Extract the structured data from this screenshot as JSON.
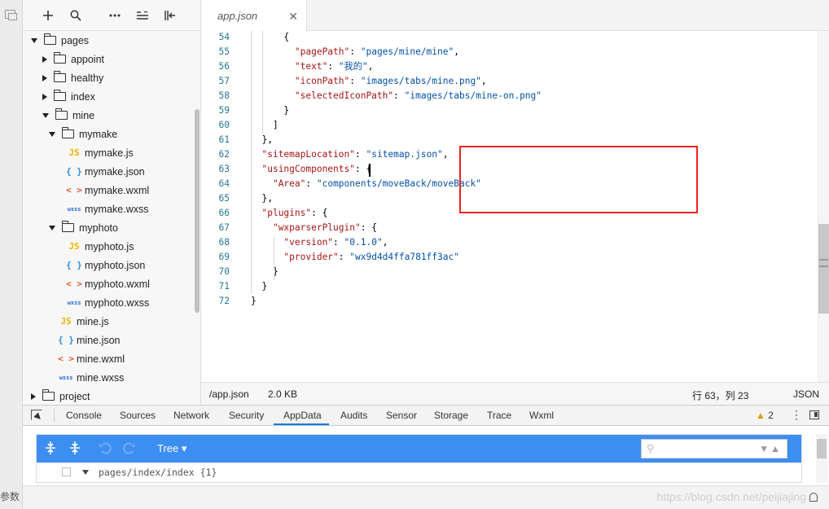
{
  "explorer": {
    "items": [
      {
        "label": "pages",
        "kind": "folder",
        "open": true,
        "depth": 0
      },
      {
        "label": "appoint",
        "kind": "folder",
        "open": false,
        "depth": 1
      },
      {
        "label": "healthy",
        "kind": "folder",
        "open": false,
        "depth": 1
      },
      {
        "label": "index",
        "kind": "folder",
        "open": false,
        "depth": 1
      },
      {
        "label": "mine",
        "kind": "folder",
        "open": true,
        "depth": 1
      },
      {
        "label": "mymake",
        "kind": "folder",
        "open": true,
        "depth": 2
      },
      {
        "label": "mymake.js",
        "kind": "js",
        "depth": 3
      },
      {
        "label": "mymake.json",
        "kind": "json",
        "depth": 3
      },
      {
        "label": "mymake.wxml",
        "kind": "wxml",
        "depth": 3
      },
      {
        "label": "mymake.wxss",
        "kind": "wxss",
        "depth": 3
      },
      {
        "label": "myphoto",
        "kind": "folder",
        "open": true,
        "depth": 2
      },
      {
        "label": "myphoto.js",
        "kind": "js",
        "depth": 3
      },
      {
        "label": "myphoto.json",
        "kind": "json",
        "depth": 3
      },
      {
        "label": "myphoto.wxml",
        "kind": "wxml",
        "depth": 3
      },
      {
        "label": "myphoto.wxss",
        "kind": "wxss",
        "depth": 3
      },
      {
        "label": "mine.js",
        "kind": "js",
        "depth": 2
      },
      {
        "label": "mine.json",
        "kind": "json",
        "depth": 2
      },
      {
        "label": "mine.wxml",
        "kind": "wxml",
        "depth": 2
      },
      {
        "label": "mine.wxss",
        "kind": "wxss",
        "depth": 2
      },
      {
        "label": "project",
        "kind": "folder",
        "open": false,
        "depth": 0
      }
    ],
    "file_icons": {
      "js": "JS",
      "json": "{ }",
      "wxml": "< >",
      "wxss": "wxss"
    }
  },
  "editor": {
    "tab_label": "app.json",
    "tab_close": "✕",
    "lines": [
      {
        "n": "54",
        "code": [
          [
            "      {",
            "p"
          ]
        ]
      },
      {
        "n": "55",
        "code": [
          [
            "        ",
            "p"
          ],
          [
            "\"pagePath\"",
            "k"
          ],
          [
            ": ",
            "p"
          ],
          [
            "\"pages/mine/mine\"",
            "s"
          ],
          [
            ",",
            "p"
          ]
        ]
      },
      {
        "n": "56",
        "code": [
          [
            "        ",
            "p"
          ],
          [
            "\"text\"",
            "k"
          ],
          [
            ": ",
            "p"
          ],
          [
            "\"我的\"",
            "s"
          ],
          [
            ",",
            "p"
          ]
        ]
      },
      {
        "n": "57",
        "code": [
          [
            "        ",
            "p"
          ],
          [
            "\"iconPath\"",
            "k"
          ],
          [
            ": ",
            "p"
          ],
          [
            "\"images/tabs/mine.png\"",
            "s"
          ],
          [
            ",",
            "p"
          ]
        ]
      },
      {
        "n": "58",
        "code": [
          [
            "        ",
            "p"
          ],
          [
            "\"selectedIconPath\"",
            "k"
          ],
          [
            ": ",
            "p"
          ],
          [
            "\"images/tabs/mine-on.png\"",
            "s"
          ]
        ]
      },
      {
        "n": "59",
        "code": [
          [
            "      }",
            "p"
          ]
        ]
      },
      {
        "n": "60",
        "code": [
          [
            "    ]",
            "p"
          ]
        ]
      },
      {
        "n": "61",
        "code": [
          [
            "  },",
            "p"
          ]
        ]
      },
      {
        "n": "62",
        "code": [
          [
            "  ",
            "p"
          ],
          [
            "\"sitemapLocation\"",
            "k"
          ],
          [
            ": ",
            "p"
          ],
          [
            "\"sitemap.json\"",
            "s"
          ],
          [
            ",",
            "p"
          ]
        ]
      },
      {
        "n": "63",
        "code": [
          [
            "  ",
            "p"
          ],
          [
            "\"usingComponents\"",
            "k"
          ],
          [
            ": {",
            "p"
          ]
        ]
      },
      {
        "n": "64",
        "code": [
          [
            "    ",
            "p"
          ],
          [
            "\"Area\"",
            "k"
          ],
          [
            ": ",
            "p"
          ],
          [
            "\"components/moveBack/moveBack\"",
            "s"
          ]
        ]
      },
      {
        "n": "65",
        "code": [
          [
            "  },",
            "p"
          ]
        ]
      },
      {
        "n": "66",
        "code": [
          [
            "  ",
            "p"
          ],
          [
            "\"plugins\"",
            "k"
          ],
          [
            ": {",
            "p"
          ]
        ]
      },
      {
        "n": "67",
        "code": [
          [
            "    ",
            "p"
          ],
          [
            "\"wxparserPlugin\"",
            "k"
          ],
          [
            ": {",
            "p"
          ]
        ]
      },
      {
        "n": "68",
        "code": [
          [
            "      ",
            "p"
          ],
          [
            "\"version\"",
            "k"
          ],
          [
            ": ",
            "p"
          ],
          [
            "\"0.1.0\"",
            "s"
          ],
          [
            ",",
            "p"
          ]
        ]
      },
      {
        "n": "69",
        "code": [
          [
            "      ",
            "p"
          ],
          [
            "\"provider\"",
            "k"
          ],
          [
            ": ",
            "p"
          ],
          [
            "\"wx9d4d4ffa781ff3ac\"",
            "s"
          ]
        ]
      },
      {
        "n": "70",
        "code": [
          [
            "    }",
            "p"
          ]
        ]
      },
      {
        "n": "71",
        "code": [
          [
            "  }",
            "p"
          ]
        ]
      },
      {
        "n": "72",
        "code": [
          [
            "}",
            "p"
          ]
        ]
      }
    ],
    "highlight_color": "#ee2222"
  },
  "status": {
    "path": "/app.json",
    "size": "2.0 KB",
    "cursor": "行 63，列 23",
    "language": "JSON"
  },
  "devtools": {
    "tabs": [
      "Console",
      "Sources",
      "Network",
      "Security",
      "AppData",
      "Audits",
      "Sensor",
      "Storage",
      "Trace",
      "Wxml"
    ],
    "active_tab": "AppData",
    "warning_count": "2",
    "appdata": {
      "view_mode": "Tree ▾",
      "row_text": "pages/index/index {1}"
    }
  },
  "left_strip_text": "参数",
  "watermark": "https://blog.csdn.net/peijiajing",
  "colors": {
    "accent": "#3c8ef1",
    "warning": "#e39b00",
    "key": "#a31515",
    "string": "#0451a5"
  }
}
